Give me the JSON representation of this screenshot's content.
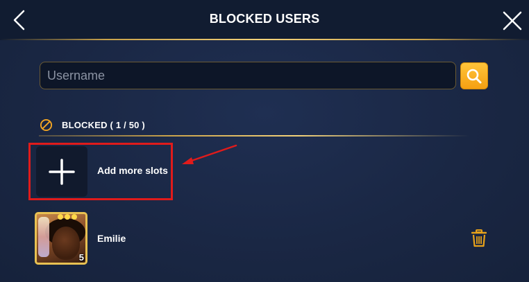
{
  "header": {
    "title": "BLOCKED USERS",
    "back_icon": "chevron-left-icon",
    "close_icon": "close-icon"
  },
  "search": {
    "placeholder": "Username",
    "value": "",
    "button_icon": "search-icon"
  },
  "blocked_section": {
    "icon": "blocked-icon",
    "label": "BLOCKED ( 1 / 50 )"
  },
  "add_slot": {
    "icon": "plus-icon",
    "label": "Add more slots"
  },
  "users": [
    {
      "name": "Emilie",
      "level": "5",
      "delete_icon": "trash-icon"
    }
  ],
  "colors": {
    "accent_gold": "#f5a012",
    "highlight_red": "#e01b1b",
    "background": "#1a2742"
  }
}
